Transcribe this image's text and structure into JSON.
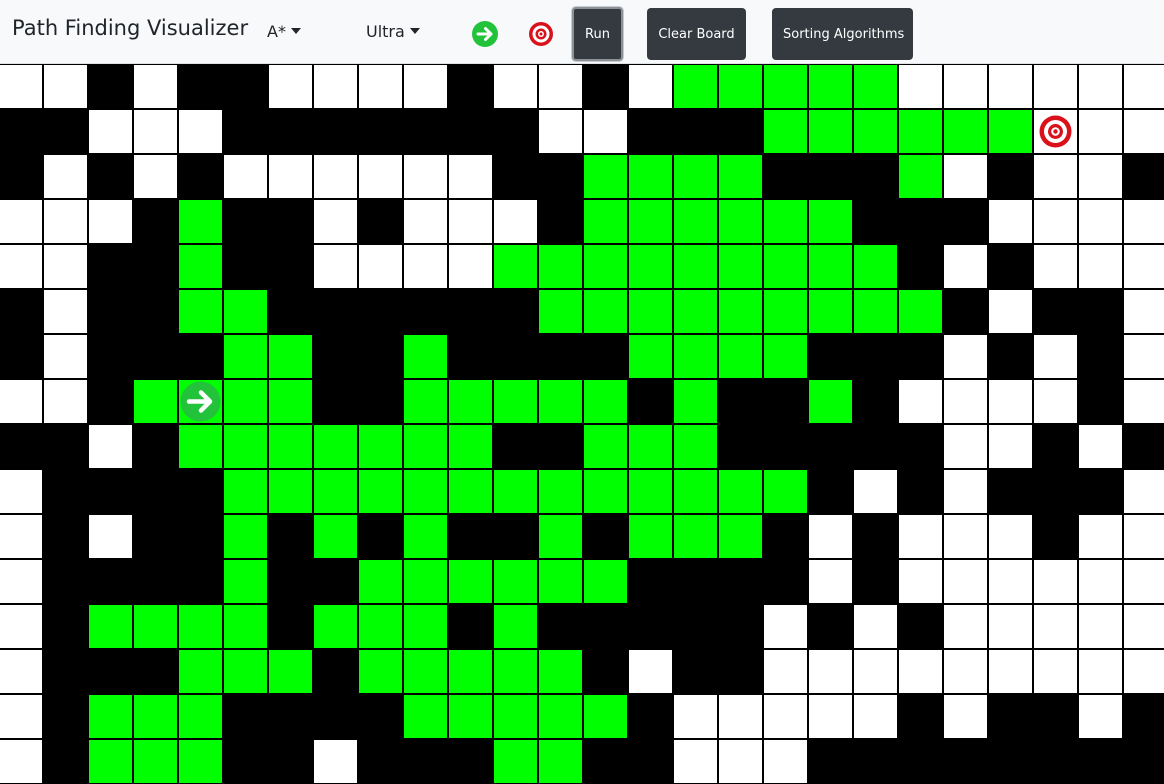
{
  "navbar": {
    "brand": "Path Finding Visualizer",
    "algorithm_dropdown": "A*",
    "speed_dropdown": "Ultra",
    "run_label": "Run",
    "clear_label": "Clear Board",
    "sorting_label": "Sorting Algorithms"
  },
  "colors": {
    "wall": "#000000",
    "visited": "#00ff00",
    "empty": "#ffffff",
    "start_icon": "#22c33a",
    "target_icon": "#d8111b",
    "button": "#343a40"
  },
  "icons": {
    "start": "arrow-right-circle-icon",
    "target": "bullseye-target-icon"
  },
  "grid": {
    "legend": {
      ".": "empty",
      "#": "wall",
      "G": "visited",
      "S": "start",
      "T": "target"
    },
    "rows": [
      "..#.##....#..#.GGGGG......",
      "##...#######..###GGGGGGT..",
      "#.#.#......##GGGG###G.#..#",
      "...#G##.#...#GGGGGG###....",
      "..##G##....GGGGGGGGG#.#...",
      "#.##GG######GGGGGGGGG#.##.",
      "#.###GG##G####GGGG###.#.#.",
      "..#GSGG##GGGGG#G##G#....#.",
      "##.#GGGGGGG##GGG#####..#.#",
      ".####GGGGGGGGGGGGG#.#.###.",
      ".#.##G#G#G##G#GGG#.#...#..",
      ".####G##GGGGGG####.#......",
      ".#GGGG#GGG#G#####.#.#.....",
      ".###GGG#GGGGG#.##.........",
      ".#GGG####GGGGG#.....#.##.#",
      ".#GGG##.###GG##...########"
    ]
  }
}
